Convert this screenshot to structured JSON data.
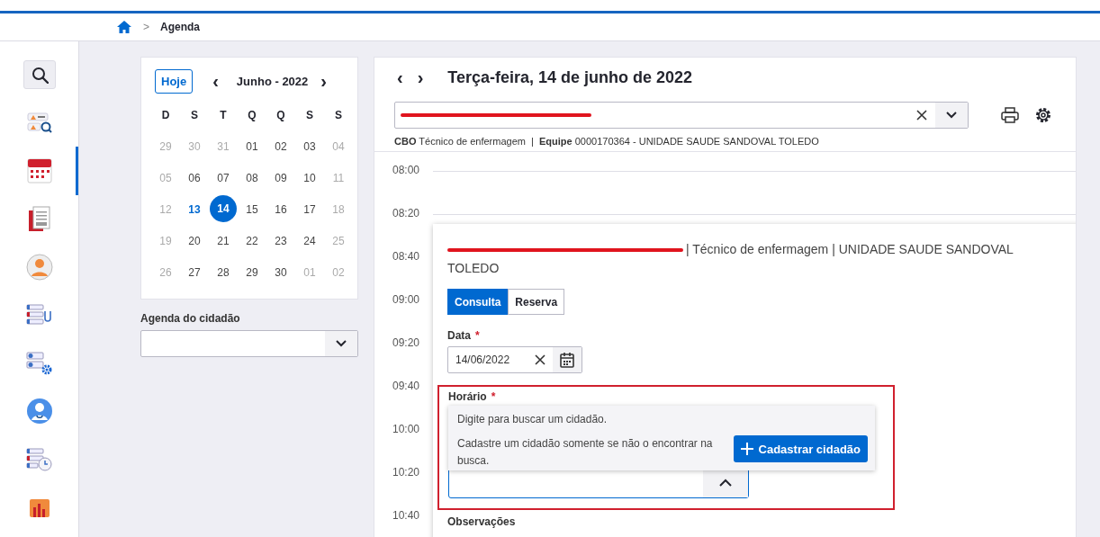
{
  "breadcrumb": {
    "separator": ">",
    "items": [
      "Agenda"
    ]
  },
  "sidebar": {
    "items": [
      {
        "kind": "search",
        "selected": false
      },
      {
        "kind": "people-search",
        "selected": false
      },
      {
        "kind": "calendar",
        "selected": true
      },
      {
        "kind": "document",
        "selected": false
      },
      {
        "kind": "person",
        "selected": false
      },
      {
        "kind": "stethoscope-list",
        "selected": false
      },
      {
        "kind": "gear-list",
        "selected": false
      },
      {
        "kind": "doctor",
        "selected": false
      },
      {
        "kind": "clock-list",
        "selected": false
      },
      {
        "kind": "chart",
        "selected": false
      }
    ]
  },
  "calendar": {
    "today_button": "Hoje",
    "prev": "‹",
    "next": "›",
    "month": "Junho - 2022",
    "weekdays": [
      "D",
      "S",
      "T",
      "Q",
      "Q",
      "S",
      "S"
    ],
    "weeks": [
      [
        {
          "day": "29",
          "muted": true,
          "today": false,
          "selected": false
        },
        {
          "day": "30",
          "muted": true,
          "today": false,
          "selected": false
        },
        {
          "day": "31",
          "muted": true,
          "today": false,
          "selected": false
        },
        {
          "day": "01",
          "muted": false,
          "today": false,
          "selected": false
        },
        {
          "day": "02",
          "muted": false,
          "today": false,
          "selected": false
        },
        {
          "day": "03",
          "muted": false,
          "today": false,
          "selected": false
        },
        {
          "day": "04",
          "muted": true,
          "today": false,
          "selected": false
        }
      ],
      [
        {
          "day": "05",
          "muted": true,
          "today": false,
          "selected": false
        },
        {
          "day": "06",
          "muted": false,
          "today": false,
          "selected": false
        },
        {
          "day": "07",
          "muted": false,
          "today": false,
          "selected": false
        },
        {
          "day": "08",
          "muted": false,
          "today": false,
          "selected": false
        },
        {
          "day": "09",
          "muted": false,
          "today": false,
          "selected": false
        },
        {
          "day": "10",
          "muted": false,
          "today": false,
          "selected": false
        },
        {
          "day": "11",
          "muted": true,
          "today": false,
          "selected": false
        }
      ],
      [
        {
          "day": "12",
          "muted": true,
          "today": false,
          "selected": false
        },
        {
          "day": "13",
          "muted": false,
          "today": true,
          "selected": false
        },
        {
          "day": "14",
          "muted": false,
          "today": false,
          "selected": true
        },
        {
          "day": "15",
          "muted": false,
          "today": false,
          "selected": false
        },
        {
          "day": "16",
          "muted": false,
          "today": false,
          "selected": false
        },
        {
          "day": "17",
          "muted": false,
          "today": false,
          "selected": false
        },
        {
          "day": "18",
          "muted": true,
          "today": false,
          "selected": false
        }
      ],
      [
        {
          "day": "19",
          "muted": true,
          "today": false,
          "selected": false
        },
        {
          "day": "20",
          "muted": false,
          "today": false,
          "selected": false
        },
        {
          "day": "21",
          "muted": false,
          "today": false,
          "selected": false
        },
        {
          "day": "22",
          "muted": false,
          "today": false,
          "selected": false
        },
        {
          "day": "23",
          "muted": false,
          "today": false,
          "selected": false
        },
        {
          "day": "24",
          "muted": false,
          "today": false,
          "selected": false
        },
        {
          "day": "25",
          "muted": true,
          "today": false,
          "selected": false
        }
      ],
      [
        {
          "day": "26",
          "muted": true,
          "today": false,
          "selected": false
        },
        {
          "day": "27",
          "muted": false,
          "today": false,
          "selected": false
        },
        {
          "day": "28",
          "muted": false,
          "today": false,
          "selected": false
        },
        {
          "day": "29",
          "muted": false,
          "today": false,
          "selected": false
        },
        {
          "day": "30",
          "muted": false,
          "today": false,
          "selected": false
        },
        {
          "day": "01",
          "muted": true,
          "today": false,
          "selected": false
        },
        {
          "day": "02",
          "muted": true,
          "today": false,
          "selected": false
        }
      ]
    ]
  },
  "citizen_agenda": {
    "label": "Agenda do cidadão"
  },
  "schedule": {
    "prev": "‹",
    "next": "›",
    "title": "Terça-feira, 14 de junho de 2022",
    "professional": {
      "redacted": true
    },
    "cbo_label": "CBO",
    "cbo": "Técnico de enfermagem",
    "separator": "|",
    "team_label": "Equipe",
    "team": "0000170364 - UNIDADE SAUDE SANDOVAL TOLEDO",
    "times": [
      "08:00",
      "08:20",
      "08:40",
      "09:00",
      "09:20",
      "09:40",
      "10:00",
      "10:20",
      "10:40"
    ]
  },
  "popup": {
    "name_redacted": true,
    "header": "| Técnico de enfermagem | UNIDADE SAUDE SANDOVAL TOLEDO",
    "types": [
      {
        "label": "Consulta",
        "selected": true
      },
      {
        "label": "Reserva",
        "selected": false
      }
    ],
    "date_label": "Data",
    "required_mark": "*",
    "date_value": "14/06/2022",
    "time_label": "Horário",
    "highlighted": true,
    "dropdown": {
      "hint": "Digite para buscar um cidadão.",
      "note": "Cadastre um cidadão somente se não o encontrar na busca.",
      "button": "Cadastrar cidadão"
    },
    "notes_label": "Observações"
  }
}
